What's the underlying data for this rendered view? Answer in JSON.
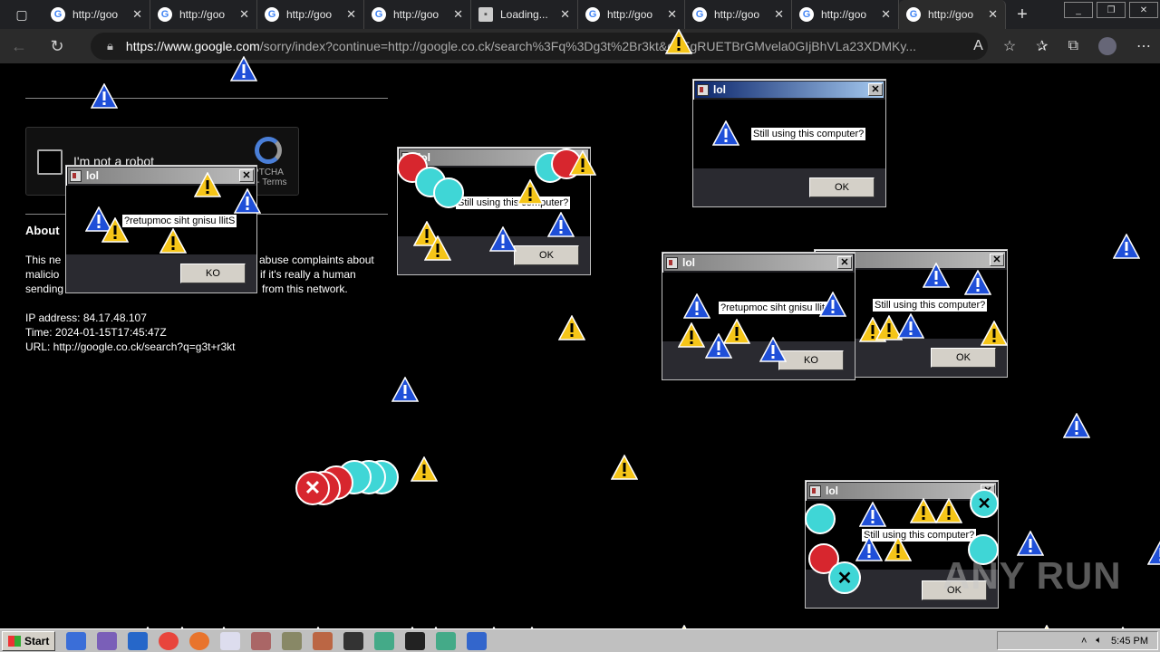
{
  "browser": {
    "tabs": [
      {
        "title": "http://goo",
        "icon": "google-icon"
      },
      {
        "title": "http://goo",
        "icon": "google-icon"
      },
      {
        "title": "http://goo",
        "icon": "google-icon"
      },
      {
        "title": "http://goo",
        "icon": "google-icon"
      },
      {
        "title": "Loading...",
        "icon": "page-icon"
      },
      {
        "title": "http://goo",
        "icon": "google-icon"
      },
      {
        "title": "http://goo",
        "icon": "google-icon"
      },
      {
        "title": "http://goo",
        "icon": "google-icon"
      },
      {
        "title": "http://goo",
        "icon": "google-icon"
      }
    ],
    "new_tab": "+",
    "url_host": "https://www.google.com",
    "url_rest": "/sorry/index?continue=http://google.co.ck/search%3Fq%3Dg3t%2Br3kt&q=EgRUETBrGMvela0GIjBhVLa23XDMKy..."
  },
  "page": {
    "captcha_label": "I'm not a robot",
    "captcha_brand": "PTCHA",
    "captcha_terms": "y - Terms",
    "about_heading": "About",
    "paragraph_lines": [
      "This ne",
      "malicio",
      "sending"
    ],
    "paragraph_right": [
      "abuse complaints about",
      "if it's really a human",
      "from this network."
    ],
    "ip_line": "IP address: 84.17.48.107",
    "time_line": "Time: 2024-01-15T17:45:47Z",
    "url_line": "URL: http://google.co.ck/search?q=g3t+r3kt"
  },
  "dialogs": [
    {
      "title": "lol",
      "message": "?retupmoc siht gnisu llitS",
      "button": "KO"
    },
    {
      "title": "lol",
      "message": "Still using this computer?",
      "button": "OK"
    },
    {
      "title": "lol",
      "message": "Still using this computer?",
      "button": "OK"
    },
    {
      "title": "lol",
      "message": "?retupmoc siht gnisu llitS",
      "button": "KO"
    },
    {
      "title": "",
      "message": "Still using this computer?",
      "button": "OK"
    },
    {
      "title": "lol",
      "message": "Still using this computer?",
      "button": "OK"
    }
  ],
  "watermark": "ANY RUN",
  "taskbar": {
    "start_label": "Start",
    "clock": "5:45 PM"
  },
  "colors": {
    "warning_yellow": "#f5c518",
    "info_blue": "#1f4fd8",
    "error_red": "#d7262e",
    "cyan_trail": "#3fd6d6"
  }
}
